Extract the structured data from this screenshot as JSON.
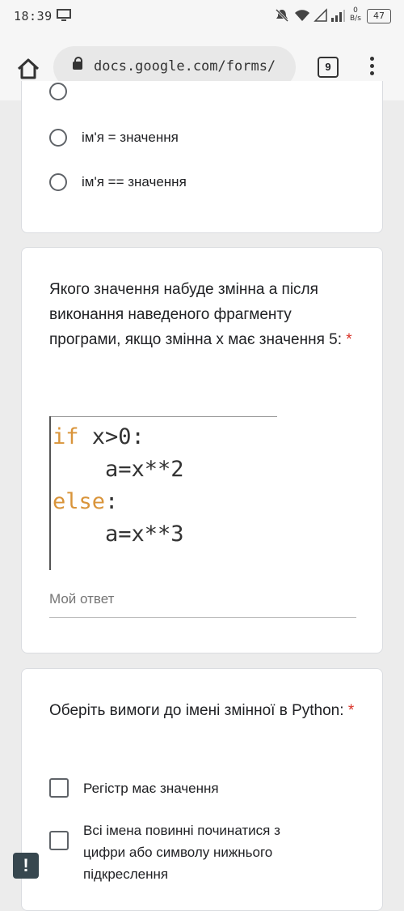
{
  "status_bar": {
    "time": "18:39",
    "net_speed_value": "0",
    "net_speed_unit": "B/s",
    "battery": "47"
  },
  "address_bar": {
    "url": "docs.google.com/forms/",
    "tab_count": "9"
  },
  "question1": {
    "options": [
      "ім'я = значення",
      "ім'я == значення"
    ]
  },
  "question2": {
    "title": "Якого значення набуде змінна а після виконання наведеного фрагменту програми, якщо змінна х має значення 5:",
    "required_mark": "*",
    "code": {
      "line1_kw": "if",
      "line1_rest": " x>0:",
      "line2": "    a=x**2",
      "line3_kw": "else",
      "line3_rest": ":",
      "line4": "    a=x**3"
    },
    "answer_placeholder": "Мой ответ"
  },
  "question3": {
    "title": "Оберіть вимоги до імені змінної в Python:",
    "required_mark": "*",
    "options": [
      "Регістр має значення",
      "Всі імена повинні починатися з цифри або символу нижнього підкреслення"
    ]
  },
  "feedback_icon": "!"
}
